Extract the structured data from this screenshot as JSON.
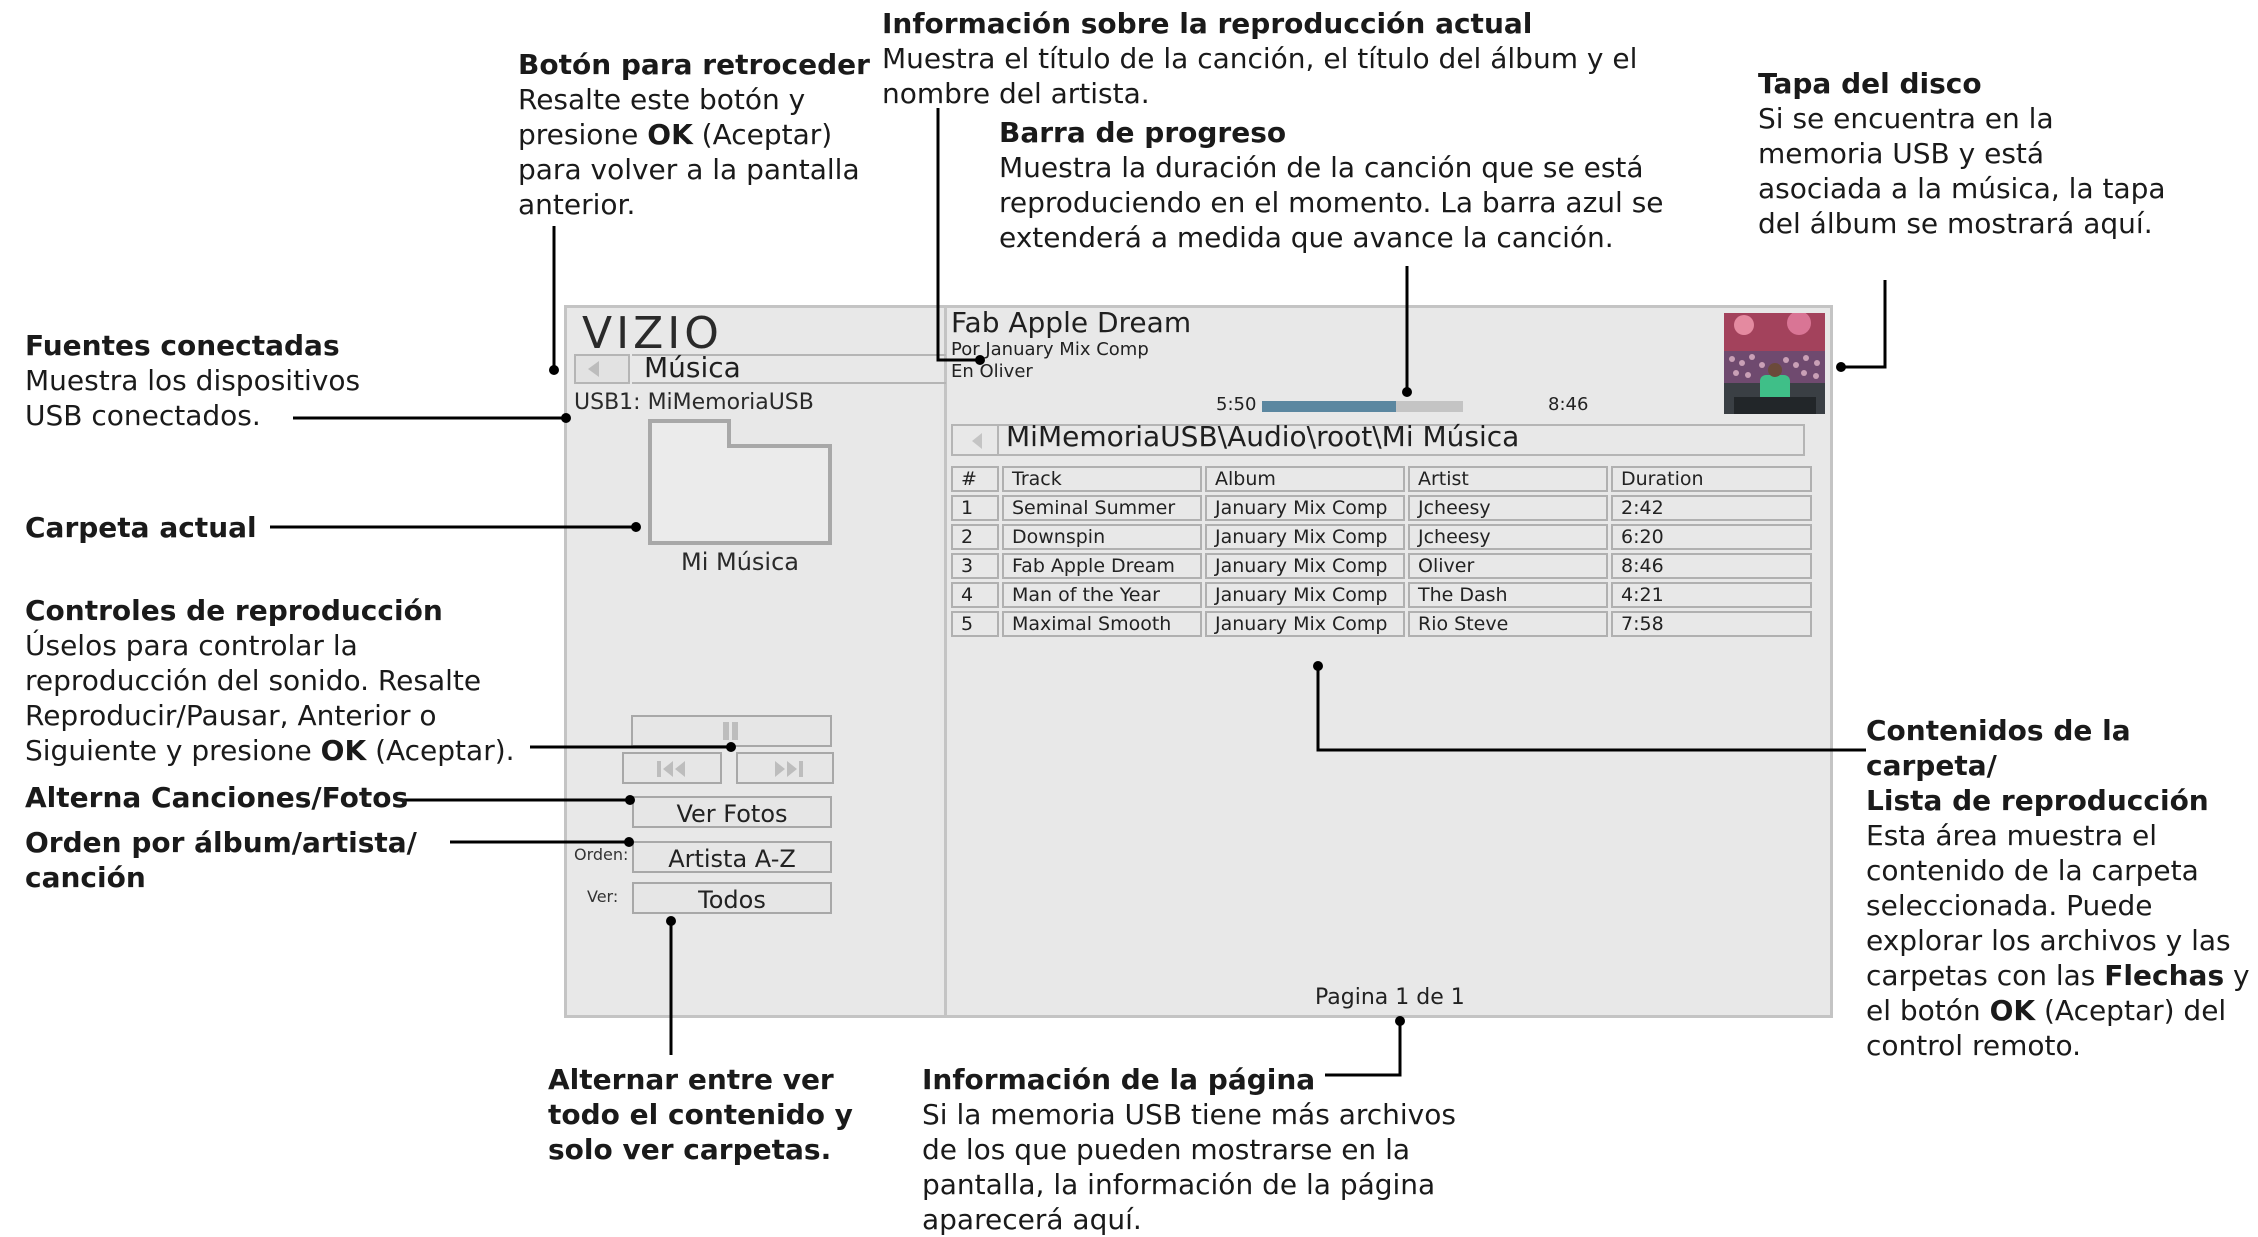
{
  "annotations": {
    "back_button": {
      "title": "Botón para retroceder",
      "line1": "Resalte este botón y",
      "line2_pre": "presione ",
      "line2_bold": "OK",
      "line2_post": " (Aceptar)",
      "line3": "para volver a la pantalla",
      "line4": "anterior."
    },
    "now_playing": {
      "title": "Información sobre la reproducción actual",
      "line1": "Muestra el título de la canción, el título del álbum y el",
      "line2": "nombre del artista."
    },
    "progress_bar": {
      "title": "Barra de progreso",
      "line1": "Muestra la duración de la canción que se está",
      "line2": "reproduciendo en el momento. La barra azul se",
      "line3": "extenderá a medida que avance la canción."
    },
    "album_cover": {
      "title": "Tapa del disco",
      "line1": "Si se encuentra en la",
      "line2": "memoria USB y está",
      "line3": "asociada a la música, la tapa",
      "line4": "del álbum se mostrará aquí."
    },
    "connected_sources": {
      "title": "Fuentes conectadas",
      "line1": "Muestra los dispositivos",
      "line2": "USB conectados."
    },
    "current_folder": {
      "title": "Carpeta actual"
    },
    "playback_controls": {
      "title": "Controles de reproducción",
      "line1": "Úselos para controlar la",
      "line2": "reproducción del sonido. Resalte",
      "line3": "Reproducir/Pausar, Anterior o",
      "line4_pre": "Siguiente y presione ",
      "line4_bold": "OK",
      "line4_post": " (Aceptar)."
    },
    "toggle_songs_photos": {
      "title": "Alterna Canciones/Fotos"
    },
    "sort_order": {
      "title_line1": "Orden por álbum/artista/",
      "title_line2": "canción"
    },
    "view_toggle": {
      "line1": "Alternar entre ver",
      "line2": "todo el contenido y",
      "line3": "solo ver carpetas."
    },
    "page_info": {
      "title": "Información de la página",
      "line1": "Si la memoria USB tiene más archivos",
      "line2": "de los que pueden mostrarse en la",
      "line3": "pantalla, la información de la página",
      "line4": "aparecerá aquí."
    },
    "folder_contents": {
      "title_line1": "Contenidos de la carpeta/",
      "title_line2": "Lista de reproducción",
      "line1": "Esta área muestra el",
      "line2": "contenido de la carpeta",
      "line3": "seleccionada. Puede",
      "line4": "explorar los archivos y las",
      "line5_pre": "carpetas con las ",
      "line5_bold": "Flechas",
      "line5_post": " y",
      "line6_pre": "el botón ",
      "line6_bold": "OK",
      "line6_post": " (Aceptar) del",
      "line7": "control remoto."
    }
  },
  "screen": {
    "logo": "VIZIO",
    "section_title": "Música",
    "usb_source": "USB1: MiMemoriaUSB",
    "folder_name": "Mi Música",
    "view_photos_button": "Ver Fotos",
    "sort_label": "Orden:",
    "sort_value": "Artista A-Z",
    "view_label": "Ver:",
    "view_value": "Todos",
    "now_playing": {
      "title": "Fab Apple Dream",
      "artist": "Por January Mix Comp",
      "album": "En Oliver"
    },
    "progress": {
      "elapsed": "5:50",
      "total": "8:46",
      "fraction": 0.665
    },
    "path": "MiMemoriaUSB\\Audio\\root\\Mi Música",
    "table": {
      "headers": [
        "#",
        "Track",
        "Album",
        "Artist",
        "Duration"
      ],
      "rows": [
        [
          "1",
          "Seminal Summer",
          "January Mix Comp",
          "Jcheesy",
          "2:42"
        ],
        [
          "2",
          "Downspin",
          "January Mix Comp",
          "Jcheesy",
          "6:20"
        ],
        [
          "3",
          "Fab Apple Dream",
          "January Mix Comp",
          "Oliver",
          "8:46"
        ],
        [
          "4",
          "Man of the Year",
          "January Mix Comp",
          "The Dash",
          "4:21"
        ],
        [
          "5",
          "Maximal Smooth",
          "January Mix Comp",
          "Rio Steve",
          "7:58"
        ]
      ]
    },
    "page_info": "Pagina 1 de 1",
    "accent_color": "#5b87a0"
  }
}
